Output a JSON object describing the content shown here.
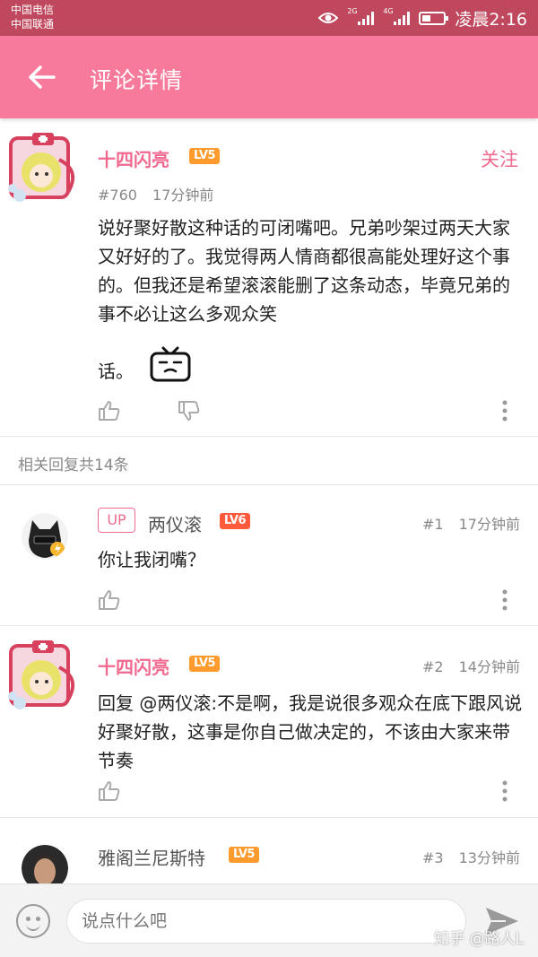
{
  "status_bar": {
    "carrier_1": "中国电信",
    "carrier_2": "中国联通",
    "net_1": "2G",
    "net_2": "4G",
    "time": "凌晨2:16"
  },
  "app_bar": {
    "title": "评论详情"
  },
  "main_comment": {
    "username": "十四闪亮",
    "level": "LV5",
    "follow_label": "关注",
    "floor": "#760",
    "time_ago": "17分钟前",
    "text": "说好聚好散这种话的可闭嘴吧。兄弟吵架过两天大家又好好的了。我觉得两人情商都很高能处理好这个事的。但我还是希望滚滚能删了这条动态，毕竟兄弟的事不必让这么多观众笑",
    "text_end": "话。"
  },
  "replies_header": "相关回复共14条",
  "replies": [
    {
      "badge": "UP",
      "username": "两仪滚",
      "level": "LV6",
      "floor": "#1",
      "time_ago": "17分钟前",
      "text": "你让我闭嘴？"
    },
    {
      "username": "十四闪亮",
      "level": "LV5",
      "floor": "#2",
      "time_ago": "14分钟前",
      "text": "回复 @两仪滚:不是啊，我是说很多观众在底下跟风说好聚好散，这事是你自己做决定的，不该由大家来带节奏"
    },
    {
      "username": "雅阁兰尼斯特",
      "level": "LV5",
      "floor": "#3",
      "time_ago": "13分钟前"
    }
  ],
  "input": {
    "placeholder": "说点什么吧"
  },
  "watermark": "知乎 @路人L",
  "colors": {
    "status_bar": "#c0485e",
    "app_bar": "#f87a9b",
    "accent": "#f06a8f",
    "lv5": "#ff9a2c",
    "lv6": "#ff5a3c"
  }
}
